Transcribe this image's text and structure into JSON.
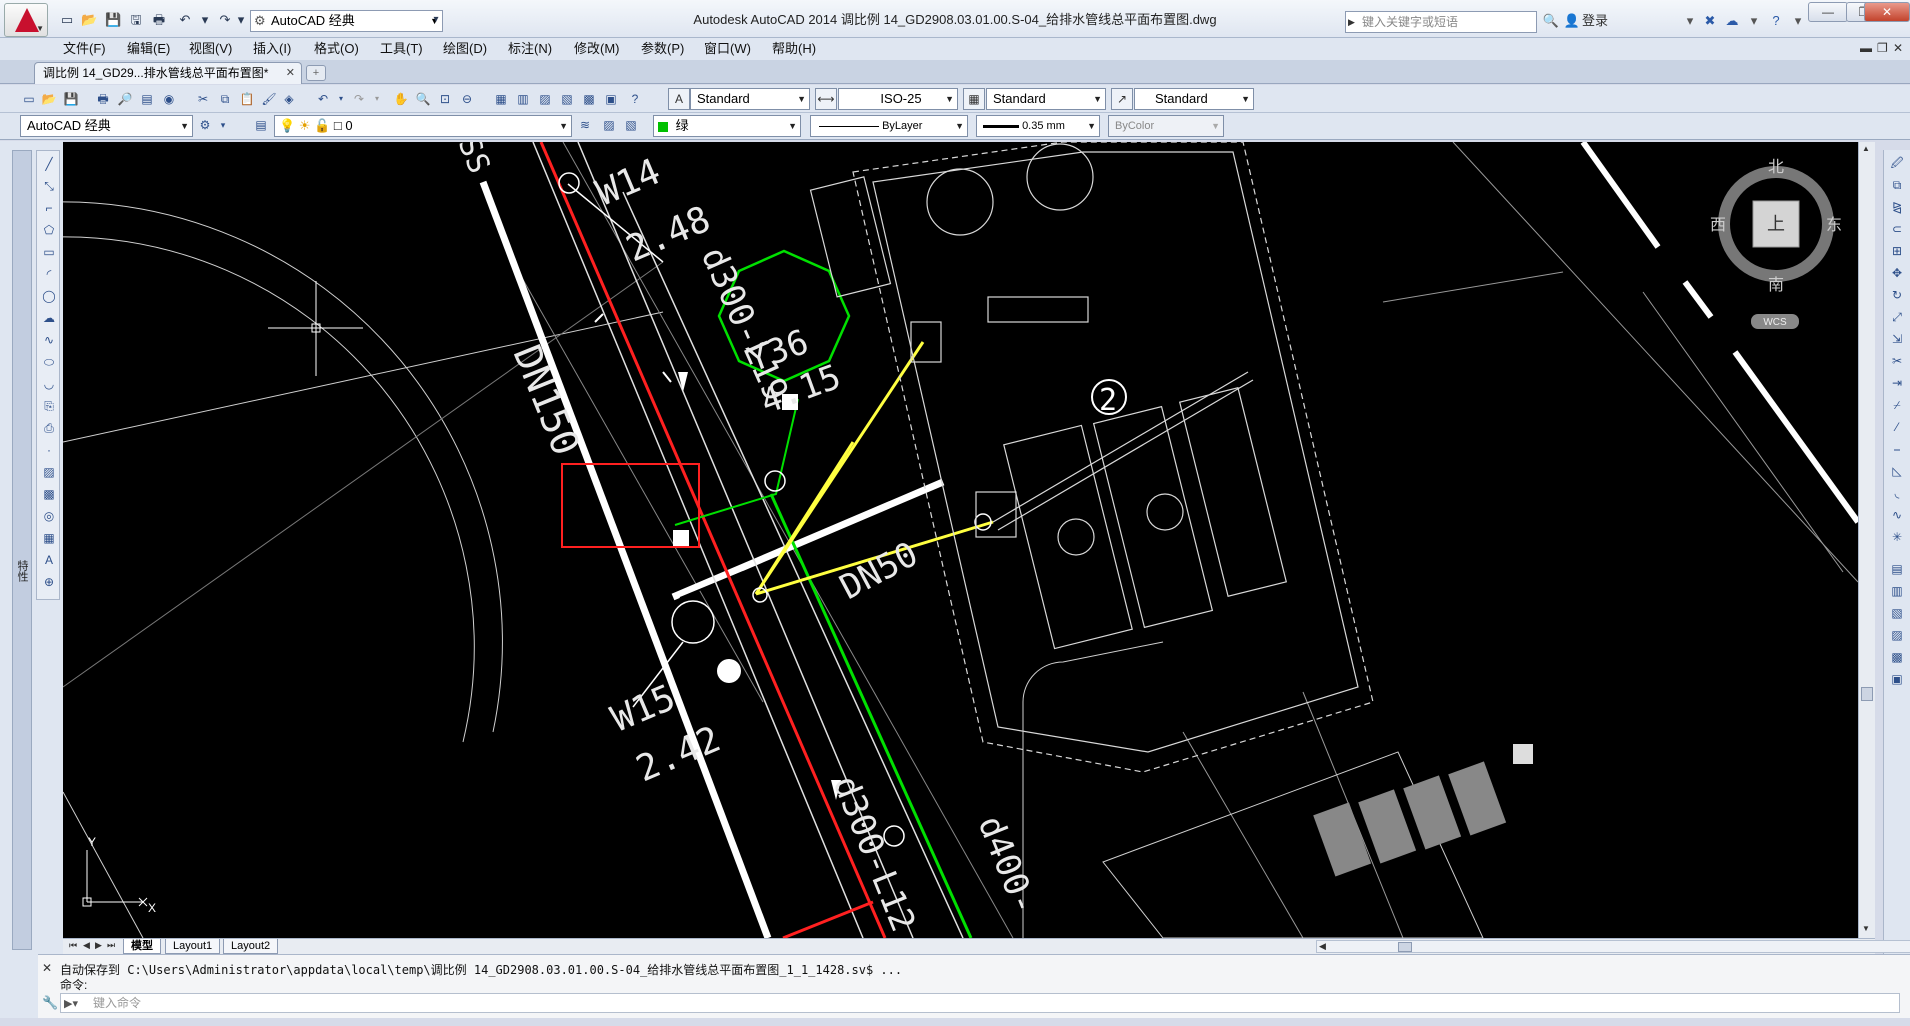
{
  "titlebar": {
    "workspace": "AutoCAD 经典",
    "title": "Autodesk AutoCAD 2014      调比例 14_GD2908.03.01.00.S-04_给排水管线总平面布置图.dwg",
    "search_placeholder": "键入关键字或短语",
    "login_label": "登录"
  },
  "menu": {
    "items": [
      "文件(F)",
      "编辑(E)",
      "视图(V)",
      "插入(I)",
      "格式(O)",
      "工具(T)",
      "绘图(D)",
      "标注(N)",
      "修改(M)",
      "参数(P)",
      "窗口(W)",
      "帮助(H)"
    ]
  },
  "tabs": {
    "doc_tab": "调比例 14_GD29...排水管线总平面布置图*"
  },
  "toolbar1": {
    "text_style": "Standard",
    "dim_style": "ISO-25",
    "table_style": "Standard",
    "mleader_style": "Standard"
  },
  "toolbar2": {
    "workspace": "AutoCAD 经典",
    "layer": "0",
    "color": "绿",
    "color_hex": "#00c000",
    "linetype": "ByLayer",
    "lineweight": "0.35 mm",
    "plotstyle": "ByColor"
  },
  "side_palette_label": "特性",
  "viewcube": {
    "north": "北",
    "south": "南",
    "west": "西",
    "east": "东",
    "face": "上",
    "wcs": "WCS"
  },
  "drawing_labels": {
    "w14": "W14",
    "w14_elev": "2.48",
    "w15": "W15",
    "w15_elev": "2.42",
    "y36": "Y36",
    "y36_elev": "4.15",
    "dn150": "DN150",
    "dn50": "DN50",
    "d300_l19": "d300-L19",
    "d300_l12": "d300-L12",
    "d400": "d400-",
    "bubble": "2",
    "ss": "SS"
  },
  "ucs": {
    "x": "X",
    "y": "Y"
  },
  "layout_tabs": [
    "模型",
    "Layout1",
    "Layout2"
  ],
  "cmdline": {
    "history1": "自动保存到 C:\\Users\\Administrator\\appdata\\local\\temp\\调比例 14_GD2908.03.01.00.S-04_给排水管线总平面布置图_1_1_1428.sv$ ...",
    "history2": "命令:",
    "placeholder": "键入命令"
  }
}
